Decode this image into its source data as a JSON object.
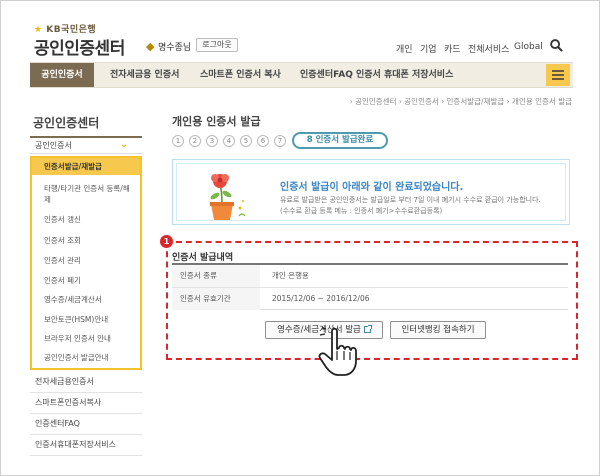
{
  "header": {
    "brand": "KB국민은행",
    "site_title": "공인인증센터",
    "user_name": "명수종님",
    "logout_label": "로그아웃",
    "util_links": [
      "개인",
      "기업",
      "카드",
      "전체서비스",
      "Global"
    ],
    "search_icon": "search-icon"
  },
  "nav": {
    "items": [
      "공인인증서",
      "전자세금용 인증서",
      "스마트폰 인증서 복사",
      "인증센터FAQ",
      "인증서 휴대폰 저장서비스"
    ],
    "active_index": 0,
    "menu_icon": "hamburger-icon"
  },
  "breadcrumb": "› 공인인증센터 › 공인인증서 › 인증서발급/재발급 › 개인용 인증서 발급",
  "sidebar": {
    "title": "공인인증센터",
    "section": "공인인증서",
    "sub_items": [
      "인증서발급/재발급",
      "타행/타기관 인증서 등록/해제",
      "인증서 갱신",
      "인증서 조회",
      "인증서 관리",
      "인증서 폐기",
      "영수증/세금계산서",
      "보안토큰(HSM)안내",
      "브라우저 인증서 안내",
      "공인인증서 발급안내"
    ],
    "items": [
      "전자세금용인증서",
      "스마트폰인증서복사",
      "인증센터FAQ",
      "인증서휴대폰저장서비스"
    ]
  },
  "main": {
    "title": "개인용 인증서 발급",
    "steps": [
      "1",
      "2",
      "3",
      "4",
      "5",
      "6",
      "7"
    ],
    "current_step": "8 인증서 발급완료",
    "notice": {
      "title": "인증서 발급이 아래와 같이 완료되었습니다.",
      "line1": "유료로 발급받은 공인인증서는 발급일로 부터 7일 이내 폐기시 수수료 환급이 가능합니다.",
      "line2": "(수수료 환급 등록 메뉴 : 인증서 폐기>수수료환급등록)"
    },
    "marker": "1",
    "section_title": "인증서 발급내역",
    "details": [
      {
        "label": "인증서 종류",
        "value": "개인 은행용"
      },
      {
        "label": "인증서 유효기간",
        "value": "2015/12/06 ~ 2016/12/06"
      }
    ],
    "receipt_button": "영수증/세금계산서 발급",
    "banking_button": "인터넷뱅킹 접속하기"
  },
  "colors": {
    "brown": "#7c6b53",
    "yellow": "#f6c94e",
    "teal": "#3a8da5",
    "red": "#d9262b"
  }
}
